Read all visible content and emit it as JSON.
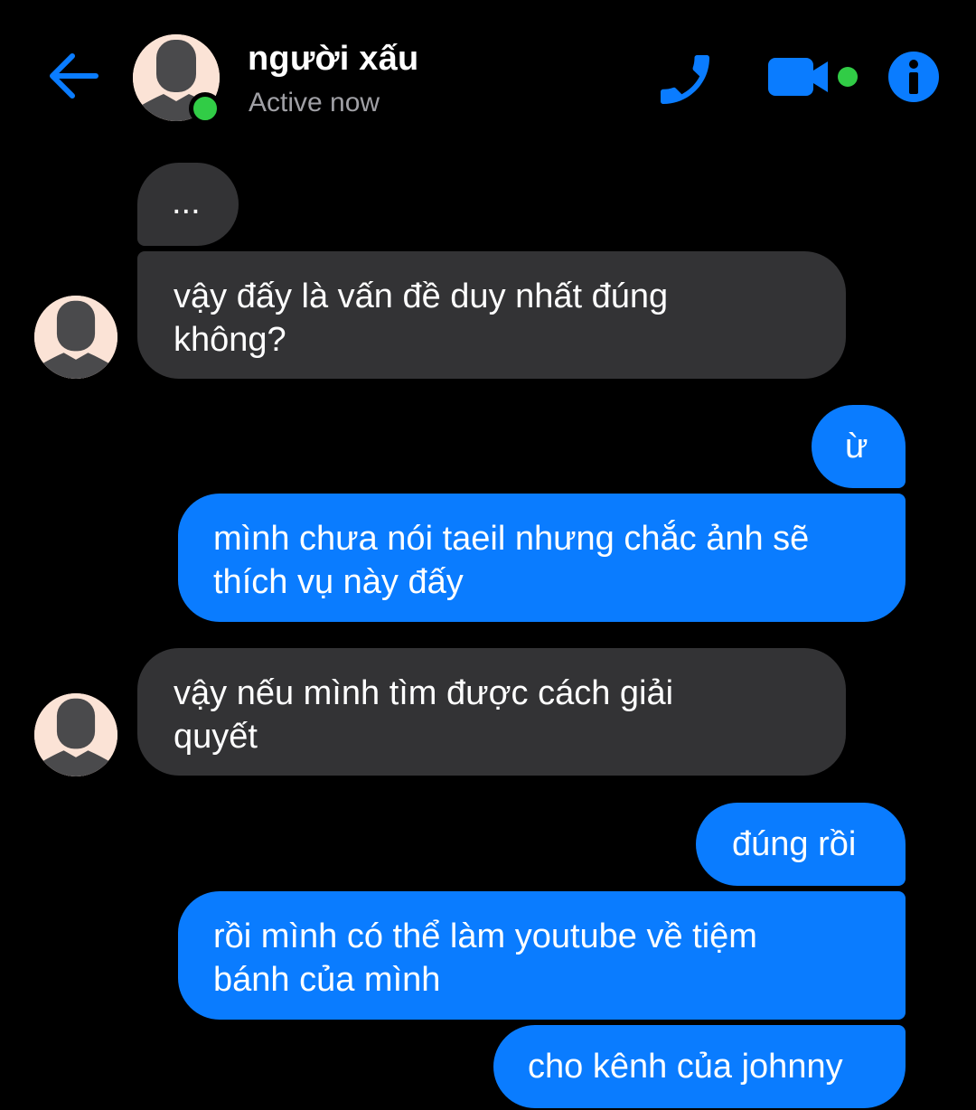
{
  "header": {
    "contact_name": "người xấu",
    "status": "Active now"
  },
  "icons": {
    "back": "arrow-left-icon",
    "call": "phone-icon",
    "video": "video-camera-icon",
    "info": "info-icon",
    "avatar": "default-avatar-icon"
  },
  "colors": {
    "background": "#000000",
    "accent": "#0a7cff",
    "incoming_bubble": "#333335",
    "online": "#31cc46",
    "status_text": "#a0a0a5"
  },
  "messages": [
    {
      "direction": "incoming",
      "text": "..."
    },
    {
      "direction": "incoming",
      "text": "vậy đấy là vấn đề duy nhất đúng không?"
    },
    {
      "direction": "outgoing",
      "text": "ừ"
    },
    {
      "direction": "outgoing",
      "text": "mình chưa nói taeil nhưng chắc ảnh sẽ thích vụ này đấy"
    },
    {
      "direction": "incoming",
      "text": "vậy nếu mình tìm được cách giải quyết"
    },
    {
      "direction": "outgoing",
      "text": "đúng rồi"
    },
    {
      "direction": "outgoing",
      "text": "rồi mình có thể làm youtube về tiệm bánh của mình"
    },
    {
      "direction": "outgoing",
      "text": "cho kênh của johnny"
    }
  ]
}
